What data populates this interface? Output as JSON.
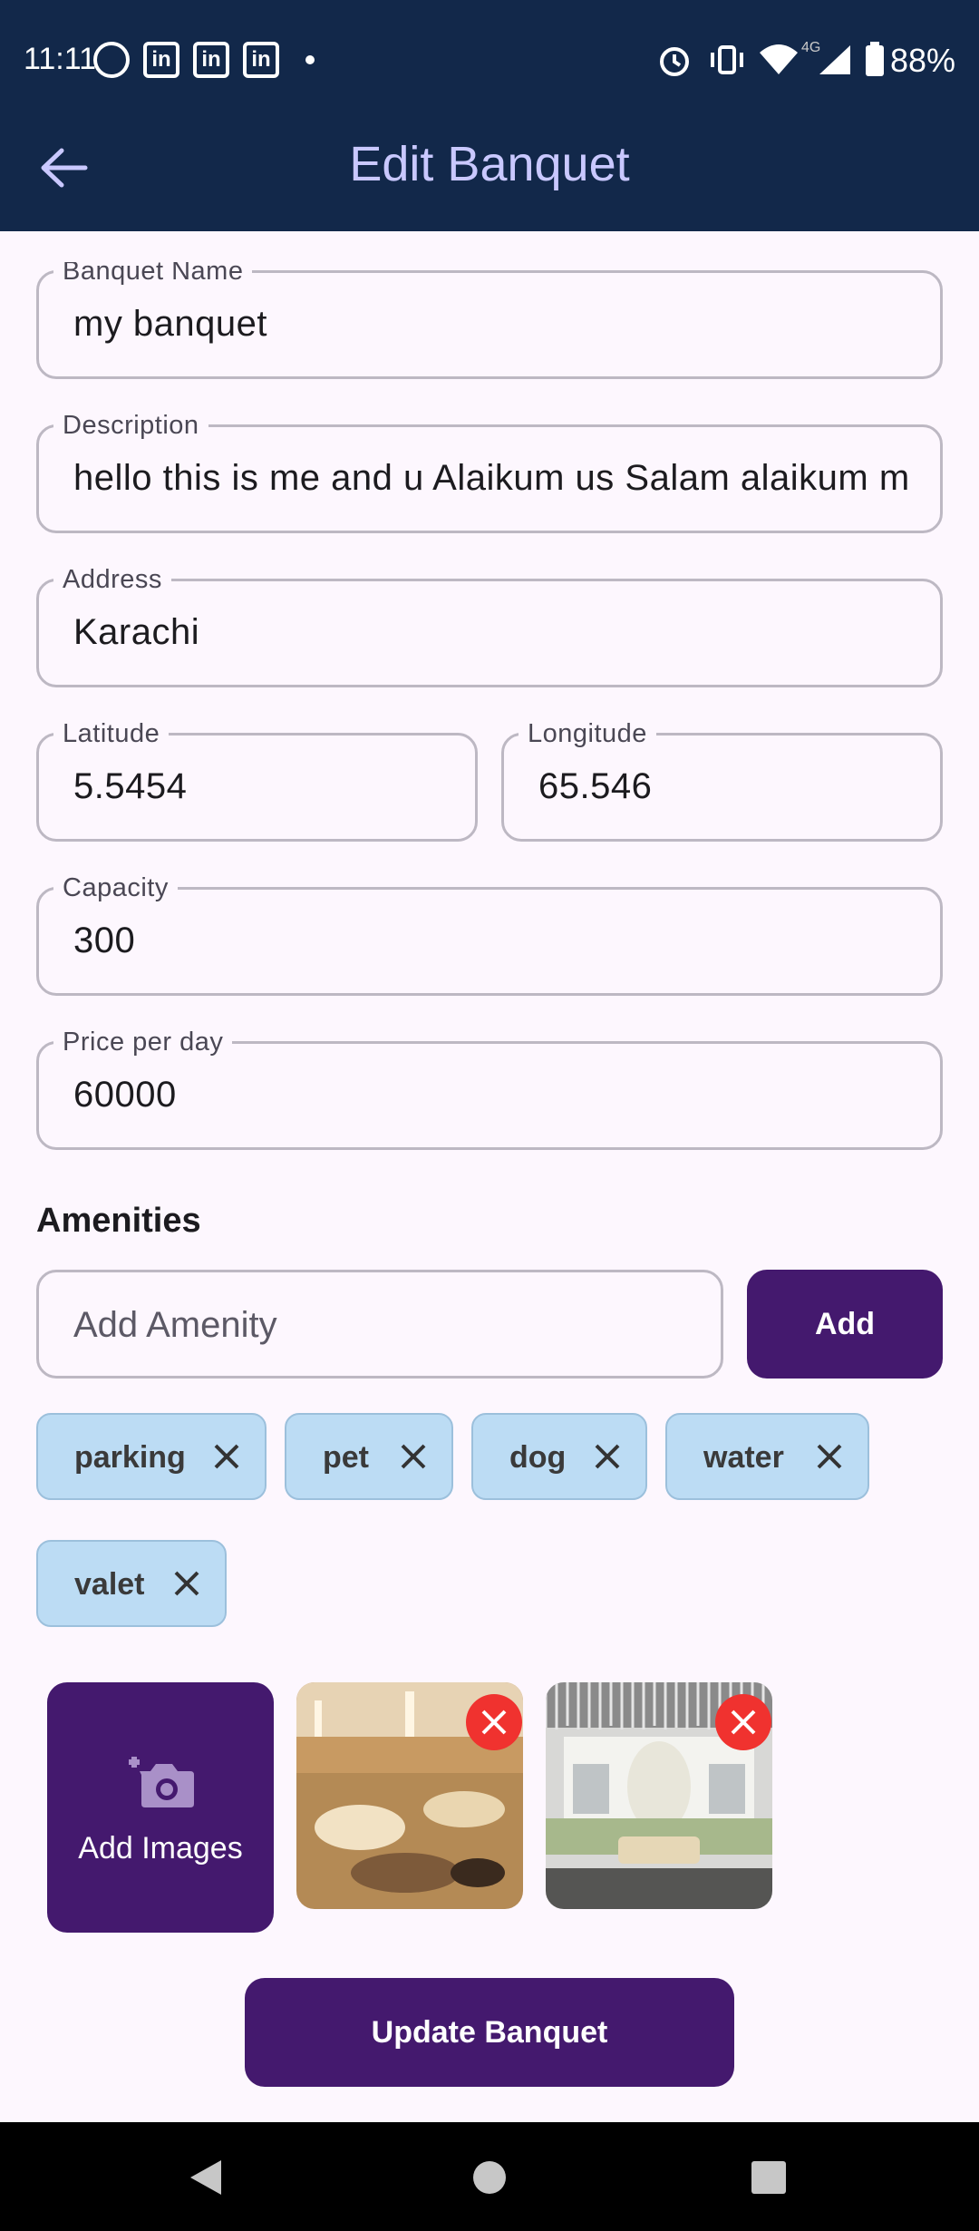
{
  "status_bar": {
    "time": "11:11",
    "battery": "88%",
    "network": "4G"
  },
  "app_bar": {
    "title": "Edit Banquet"
  },
  "form": {
    "banquet_name": {
      "label": "Banquet Name",
      "value": "my banquet"
    },
    "description": {
      "label": "Description",
      "value": "hello this is me and u Alaikum us Salam alaikum m"
    },
    "address": {
      "label": "Address",
      "value": "Karachi"
    },
    "latitude": {
      "label": "Latitude",
      "value": "5.5454"
    },
    "longitude": {
      "label": "Longitude",
      "value": "65.546"
    },
    "capacity": {
      "label": "Capacity",
      "value": "300"
    },
    "price": {
      "label": "Price per day",
      "value": "60000"
    }
  },
  "amenities": {
    "title": "Amenities",
    "input_placeholder": "Add Amenity",
    "add_label": "Add",
    "chips": [
      "parking",
      "pet",
      "dog",
      "water",
      "valet"
    ]
  },
  "images": {
    "add_label": "Add Images"
  },
  "update_label": "Update Banquet",
  "colors": {
    "header": "#12284a",
    "primary": "#44196e",
    "chip": "#bcdcf4",
    "remove": "#f0322f"
  }
}
